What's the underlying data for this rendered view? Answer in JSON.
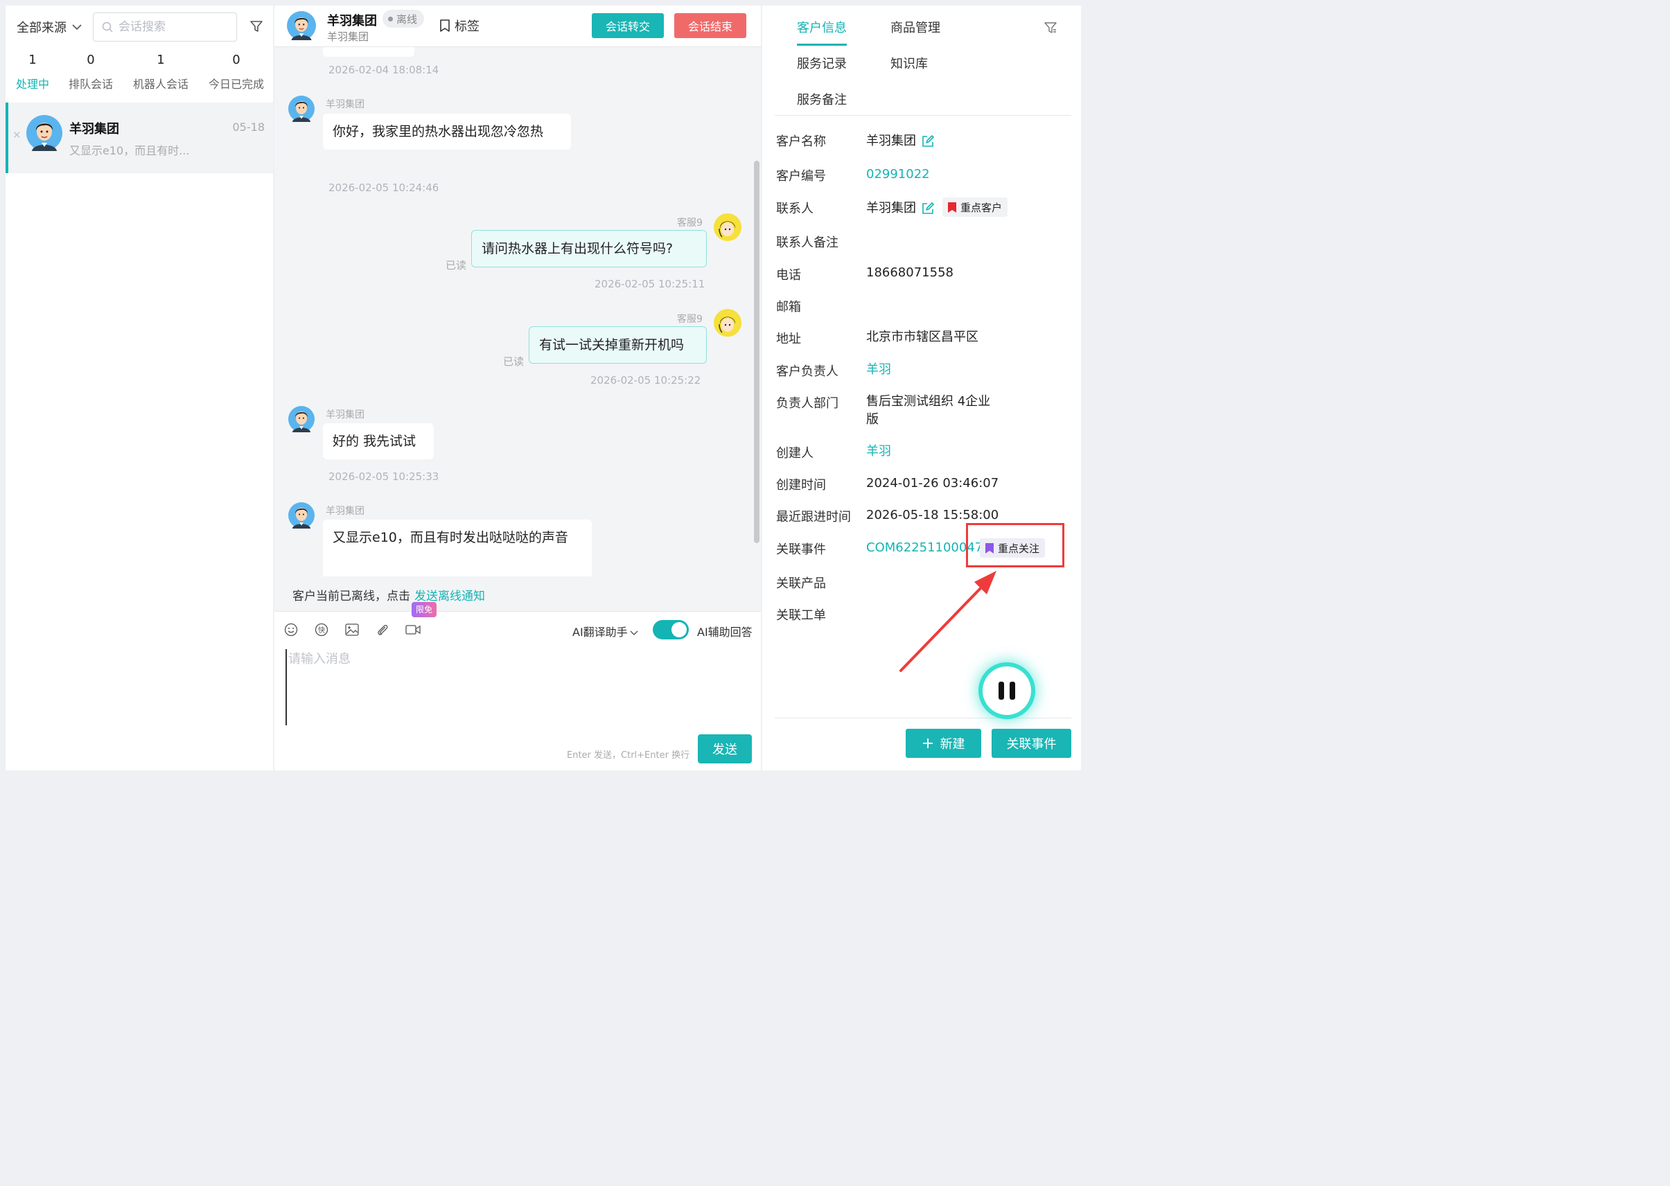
{
  "left": {
    "source_label": "全部来源",
    "search_placeholder": "会话搜索",
    "stats": [
      {
        "num": "1",
        "label": "处理中"
      },
      {
        "num": "0",
        "label": "排队会话"
      },
      {
        "num": "1",
        "label": "机器人会话"
      },
      {
        "num": "0",
        "label": "今日已完成"
      }
    ],
    "conversation": {
      "name": "羊羽集团",
      "date": "05-18",
      "preview": "又显示e10，而且有时..."
    }
  },
  "chat": {
    "title": "羊羽集团",
    "status": "离线",
    "subtitle": "羊羽集团",
    "tag_label": "标签",
    "transfer_label": "会话转交",
    "end_label": "会话结束",
    "messages": [
      {
        "time": "2026-02-04 18:08:14"
      },
      {
        "sender": "羊羽集团",
        "text": "你好，我家里的热水器出现忽冷忽热",
        "time": "2026-02-05 10:24:46"
      },
      {
        "sender": "客服9",
        "text": "请问热水器上有出现什么符号吗?",
        "read": "已读",
        "time": "2026-02-05 10:25:11"
      },
      {
        "sender": "客服9",
        "text": "有试一试关掉重新开机吗",
        "read": "已读",
        "time": "2026-02-05 10:25:22"
      },
      {
        "sender": "羊羽集团",
        "text": "好的 我先试试",
        "time": "2026-02-05 10:25:33"
      },
      {
        "sender": "羊羽集团",
        "text": "又显示e10，而且有时发出哒哒哒的声音"
      }
    ],
    "notice_text": "客户当前已离线，点击",
    "notice_link": "发送离线通知",
    "xianmian": "限免",
    "ai_translate": "AI翻译助手",
    "ai_assist": "AI辅助回答",
    "input_placeholder": "请输入消息",
    "hint": "Enter 发送，Ctrl+Enter 换行",
    "send_label": "发送"
  },
  "right": {
    "tabs": [
      "客户信息",
      "商品管理",
      "服务记录",
      "知识库",
      "服务备注"
    ],
    "fields": {
      "customer_name_label": "客户名称",
      "customer_name": "羊羽集团",
      "customer_no_label": "客户编号",
      "customer_no": "02991022",
      "contact_label": "联系人",
      "contact": "羊羽集团",
      "contact_tag": "重点客户",
      "contact_note_label": "联系人备注",
      "phone_label": "电话",
      "phone": "18668071558",
      "email_label": "邮箱",
      "address_label": "地址",
      "address": "北京市市辖区昌平区",
      "owner_label": "客户负责人",
      "owner": "羊羽",
      "dept_label": "负责人部门",
      "dept_line1": "售后宝测试组织 4企业",
      "dept_line2": "版",
      "creator_label": "创建人",
      "creator": "羊羽",
      "created_label": "创建时间",
      "created": "2024-01-26 03:46:07",
      "followup_label": "最近跟进时间",
      "followup": "2026-05-18 15:58:00",
      "event_label": "关联事件",
      "event": "COM62251100047",
      "event_tag": "重点关注",
      "product_label": "关联产品",
      "workorder_label": "关联工单"
    },
    "new_label": "新建",
    "link_event_label": "关联事件"
  },
  "colors": {
    "accent": "#14b4b4",
    "danger": "#f06a6a",
    "annotation": "#ef3b3b"
  }
}
